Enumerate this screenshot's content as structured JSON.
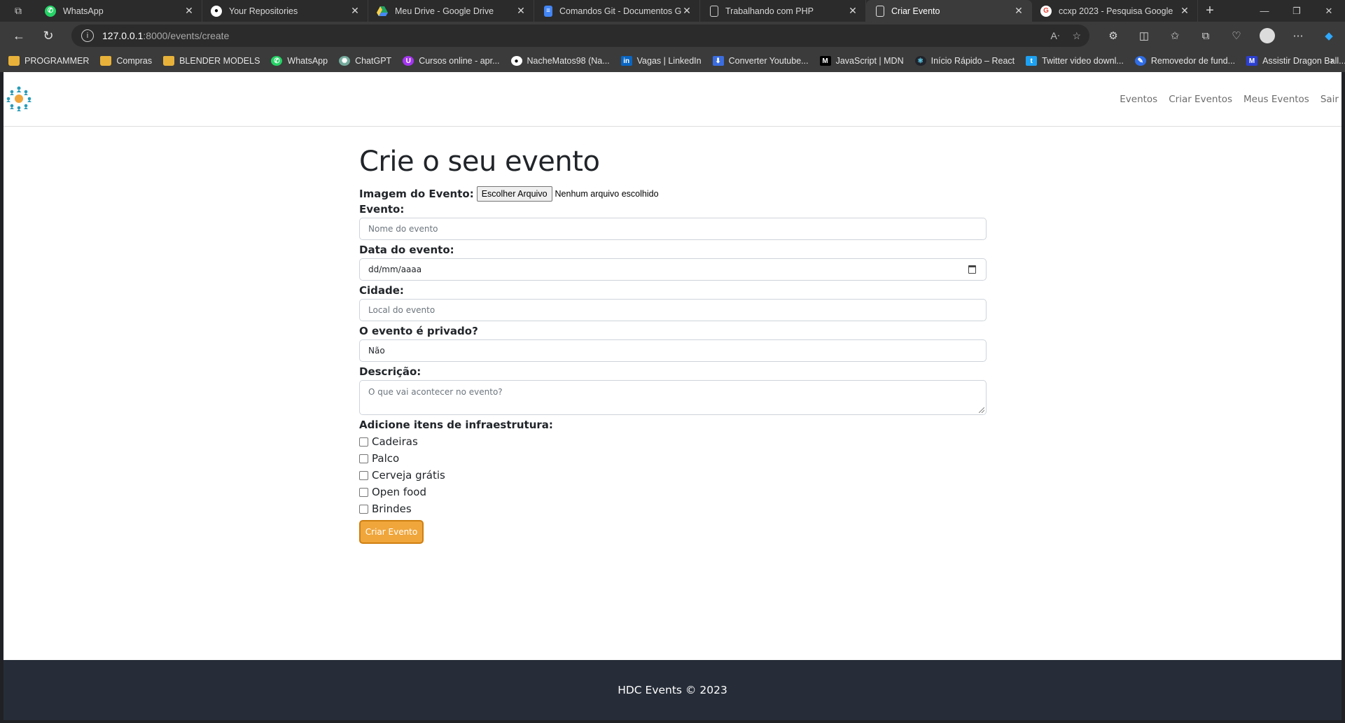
{
  "browser": {
    "tabs": [
      {
        "title": "WhatsApp",
        "icon": "whatsapp-icon",
        "color": "#25d366"
      },
      {
        "title": "Your Repositories",
        "icon": "github-icon",
        "color": "#ffffff"
      },
      {
        "title": "Meu Drive - Google Drive",
        "icon": "google-drive-icon",
        "color": "#1fa463"
      },
      {
        "title": "Comandos Git - Documentos Go",
        "icon": "google-docs-icon",
        "color": "#4285f4"
      },
      {
        "title": "Trabalhando com PHP",
        "icon": "page-icon",
        "color": "#cfcfcf"
      },
      {
        "title": "Criar Evento",
        "icon": "page-icon",
        "color": "#cfcfcf",
        "active": true
      },
      {
        "title": "ccxp 2023 - Pesquisa Google",
        "icon": "google-icon",
        "color": "#ea4335"
      }
    ],
    "url_host": "127.0.0.1",
    "url_path": ":8000/events/create",
    "bookmarks": [
      {
        "label": "PROGRAMMER",
        "icon": "folder-icon"
      },
      {
        "label": "Compras",
        "icon": "folder-icon"
      },
      {
        "label": "BLENDER MODELS",
        "icon": "folder-icon"
      },
      {
        "label": "WhatsApp",
        "icon": "whatsapp-icon"
      },
      {
        "label": "ChatGPT",
        "icon": "chatgpt-icon"
      },
      {
        "label": "Cursos online - apr...",
        "icon": "udemy-icon"
      },
      {
        "label": "NacheMatos98 (Na...",
        "icon": "github-icon"
      },
      {
        "label": "Vagas | LinkedIn",
        "icon": "linkedin-icon"
      },
      {
        "label": "Converter Youtube...",
        "icon": "download-icon"
      },
      {
        "label": "JavaScript | MDN",
        "icon": "mdn-icon"
      },
      {
        "label": "Início Rápido – React",
        "icon": "react-icon"
      },
      {
        "label": "Twitter video downl...",
        "icon": "twitter-icon"
      },
      {
        "label": "Removedor de fund...",
        "icon": "remover-icon"
      },
      {
        "label": "Assistir Dragon Ball...",
        "icon": "play-icon"
      }
    ]
  },
  "site": {
    "nav": [
      "Eventos",
      "Criar Eventos",
      "Meus Eventos",
      "Sair"
    ],
    "footer": "HDC Events © 2023"
  },
  "form": {
    "title": "Crie o seu evento",
    "image_label": "Imagem do Evento:",
    "file_button": "Escolher Arquivo",
    "file_status": "Nenhum arquivo escolhido",
    "event_label": "Evento:",
    "event_placeholder": "Nome do evento",
    "date_label": "Data do evento:",
    "date_placeholder": "dd/mm/aaaa",
    "city_label": "Cidade:",
    "city_placeholder": "Local do evento",
    "private_label": "O evento é privado?",
    "private_value": "Não",
    "description_label": "Descrição:",
    "description_placeholder": "O que vai acontecer no evento?",
    "items_label": "Adicione itens de infraestrutura:",
    "items": [
      "Cadeiras",
      "Palco",
      "Cerveja grátis",
      "Open food",
      "Brindes"
    ],
    "submit": "Criar Evento"
  },
  "colors": {
    "accent": "#f0a63b",
    "footer_bg": "#262d38"
  }
}
